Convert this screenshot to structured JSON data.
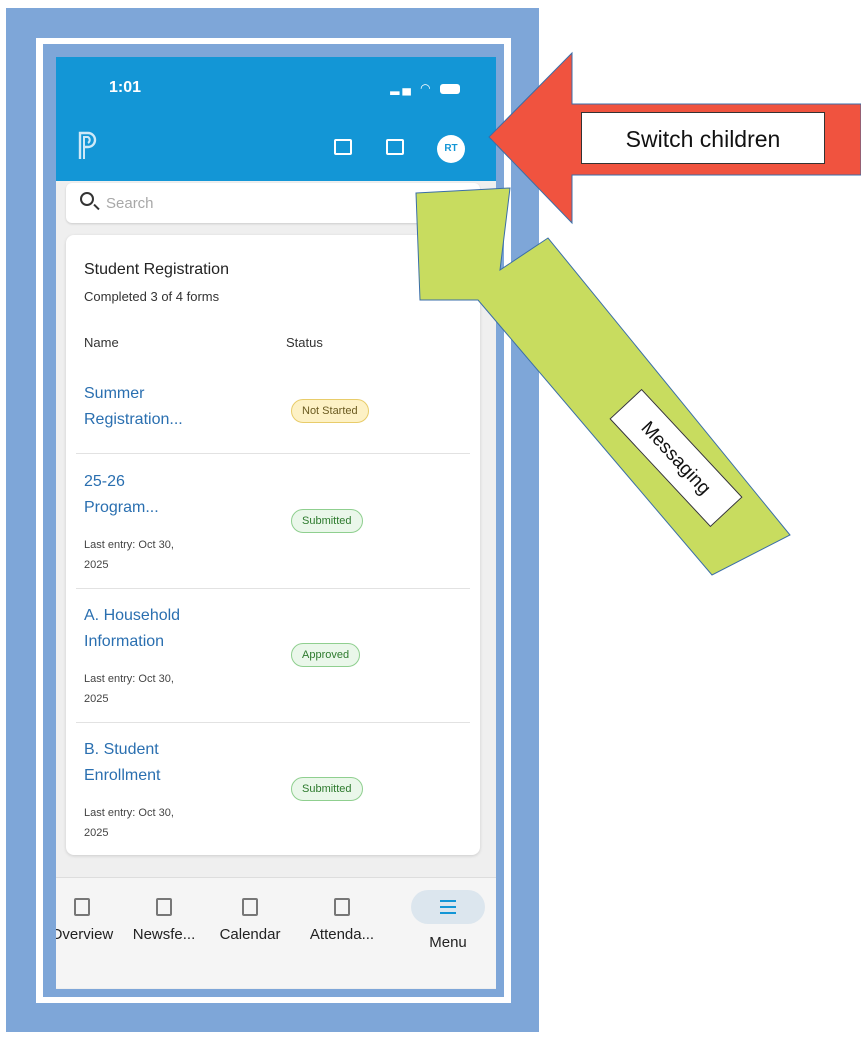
{
  "status_bar": {
    "time": "1:01"
  },
  "header": {
    "avatar_initials": "RT"
  },
  "search": {
    "placeholder": "Search"
  },
  "registration": {
    "title": "Student Registration",
    "subtitle": "Completed 3 of 4 forms",
    "col_name": "Name",
    "col_status": "Status",
    "forms": [
      {
        "name_line1": "Summer",
        "name_line2": "Registration...",
        "last_entry_line1": "",
        "last_entry_line2": "",
        "status": "Not Started"
      },
      {
        "name_line1": "25-26",
        "name_line2": "Program...",
        "last_entry_line1": "Last entry: Oct 30,",
        "last_entry_line2": "2025",
        "status": "Submitted"
      },
      {
        "name_line1": "A. Household",
        "name_line2": "Information",
        "last_entry_line1": "Last entry: Oct 30,",
        "last_entry_line2": "2025",
        "status": "Approved"
      },
      {
        "name_line1": "B. Student",
        "name_line2": "Enrollment",
        "last_entry_line1": "Last entry: Oct 30,",
        "last_entry_line2": "2025",
        "status": "Submitted"
      }
    ]
  },
  "tabs": [
    {
      "label": "Overview",
      "icon": "overview-icon"
    },
    {
      "label": "Newsfe...",
      "icon": "newsfeed-icon"
    },
    {
      "label": "Calendar",
      "icon": "calendar-icon"
    },
    {
      "label": "Attenda...",
      "icon": "attendance-icon"
    },
    {
      "label": "Menu",
      "icon": "menu-icon"
    }
  ],
  "annotations": {
    "switch_children": "Switch children",
    "messaging": "Messaging"
  },
  "colors": {
    "header_blue": "#1396d6",
    "frame_blue": "#7ea6d8",
    "arrow_red": "#f0533f",
    "arrow_green": "#c8dc5f",
    "link_blue": "#2a6fb0"
  }
}
